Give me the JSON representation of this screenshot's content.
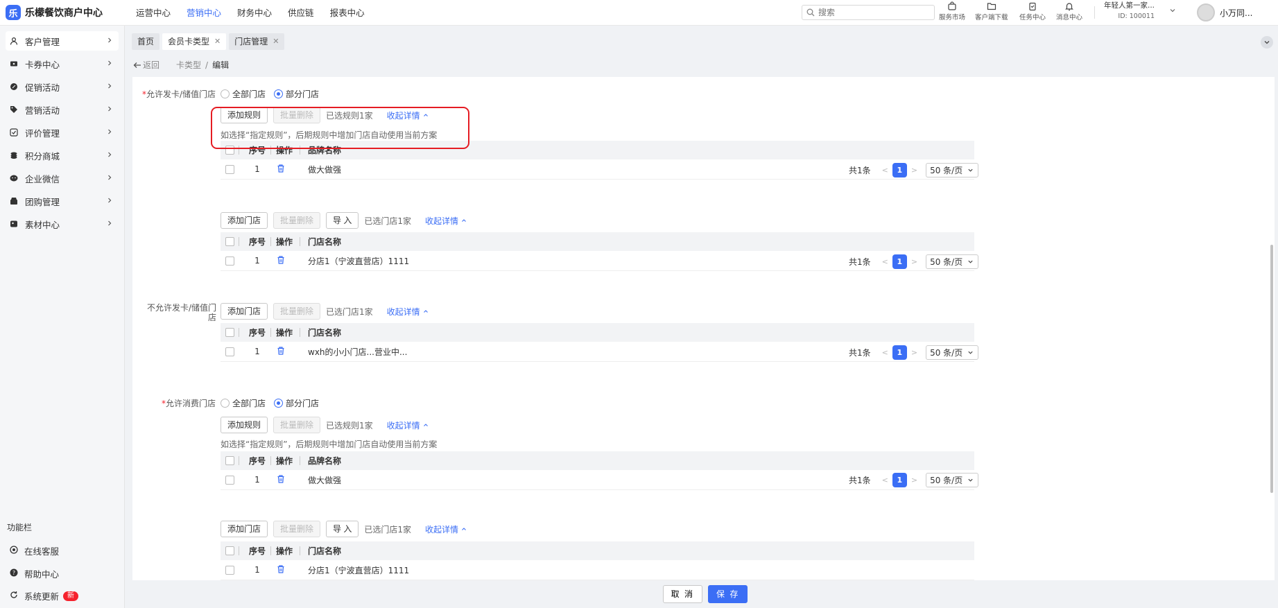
{
  "app": {
    "logo_mark": "乐",
    "title": "乐檬餐饮商户中心"
  },
  "topnav": [
    {
      "label": "运营中心",
      "active": false
    },
    {
      "label": "营销中心",
      "active": true
    },
    {
      "label": "财务中心",
      "active": false
    },
    {
      "label": "供应链",
      "active": false
    },
    {
      "label": "报表中心",
      "active": false
    }
  ],
  "search": {
    "placeholder": "搜索"
  },
  "tools": [
    {
      "label": "服务市场",
      "icon": "shop-icon"
    },
    {
      "label": "客户端下载",
      "icon": "download-folder-icon"
    },
    {
      "label": "任务中心",
      "icon": "clipboard-icon"
    },
    {
      "label": "消息中心",
      "icon": "bell-icon"
    }
  ],
  "account": {
    "name": "年轻人第一家...",
    "id": "ID: 100011"
  },
  "user": {
    "name": "小万同..."
  },
  "sidebar": {
    "items": [
      {
        "label": "客户管理",
        "icon": "user-icon"
      },
      {
        "label": "卡券中心",
        "icon": "ticket-icon"
      },
      {
        "label": "促销活动",
        "icon": "promo-icon"
      },
      {
        "label": "营销活动",
        "icon": "tag-icon"
      },
      {
        "label": "评价管理",
        "icon": "review-icon"
      },
      {
        "label": "积分商城",
        "icon": "coins-icon"
      },
      {
        "label": "企业微信",
        "icon": "wechat-icon"
      },
      {
        "label": "团购管理",
        "icon": "group-buy-icon"
      },
      {
        "label": "素材中心",
        "icon": "material-icon"
      }
    ],
    "func_title": "功能栏",
    "func_items": [
      {
        "label": "在线客服",
        "icon": "headset-icon"
      },
      {
        "label": "帮助中心",
        "icon": "help-icon"
      },
      {
        "label": "系统更新",
        "icon": "refresh-icon",
        "badge": "新"
      }
    ]
  },
  "tabs": [
    {
      "label": "首页",
      "closable": false
    },
    {
      "label": "会员卡类型",
      "closable": true,
      "current": true
    },
    {
      "label": "门店管理",
      "closable": true
    }
  ],
  "breadcrumb": {
    "back": "返回",
    "path1": "卡类型",
    "sep": "/",
    "current": "编辑"
  },
  "form": {
    "issue_label": "允许发卡/储值门店",
    "issue_options": [
      "全部门店",
      "部分门店"
    ],
    "add_rule": "添加规则",
    "batch_delete": "批量删除",
    "rule_count": "已选规则1家",
    "collapse": "收起详情",
    "hint": "如选择“指定规则”，后期规则中增加门店自动使用当前方案",
    "add_store": "添加门店",
    "import": "导 入",
    "store_count": "已选门店1家",
    "col_no": "序号",
    "col_op": "操作",
    "col_brand": "品牌名称",
    "col_store": "门店名称",
    "brand_row": {
      "no": "1",
      "name": "做大做强"
    },
    "store_row": {
      "no": "1",
      "name": "分店1（宁波直营店）1111"
    },
    "deny_label_1": "不允许发卡/储值门",
    "deny_label_2": "店",
    "deny_row": {
      "no": "1",
      "name": "wxh的小小门店...营业中..."
    },
    "consume_label": "允许消费门店",
    "pager": {
      "total": "共1条",
      "page": "1",
      "size": "50 条/页"
    }
  },
  "actions": {
    "cancel": "取 消",
    "save": "保 存"
  }
}
